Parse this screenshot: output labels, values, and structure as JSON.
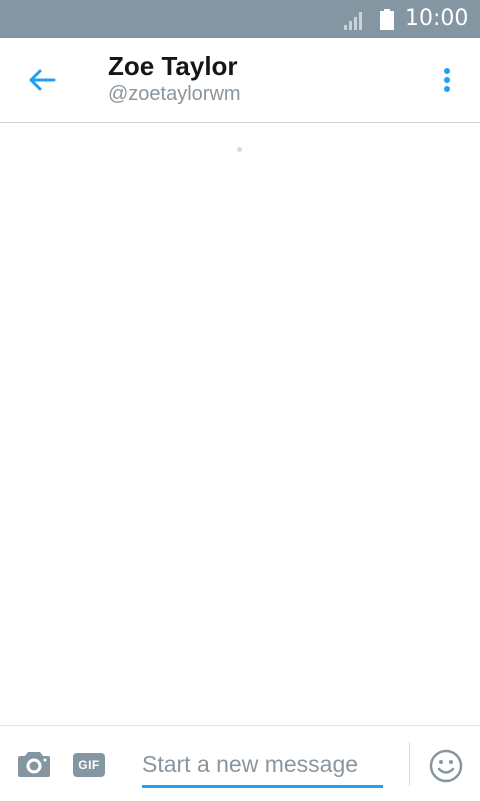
{
  "status_bar": {
    "time": "10:00",
    "signal_icon": "signal-icon",
    "battery_icon": "battery-icon"
  },
  "toolbar": {
    "back_icon": "arrow-left-icon",
    "title": "Zoe Taylor",
    "subtitle": "@zoetaylorwm",
    "overflow_icon": "more-vertical-icon"
  },
  "conversation": {
    "loading_indicator": "loading-dot"
  },
  "composer": {
    "camera_icon": "camera-icon",
    "gif_label": "GIF",
    "placeholder": "Start a new message",
    "value": "",
    "emoji_icon": "emoji-icon"
  },
  "colors": {
    "status_bar_bg": "#8596a3",
    "accent": "#1da1f2",
    "title_text": "#14171a",
    "secondary_text": "#8a959e",
    "icon_gray": "#8596a3"
  }
}
